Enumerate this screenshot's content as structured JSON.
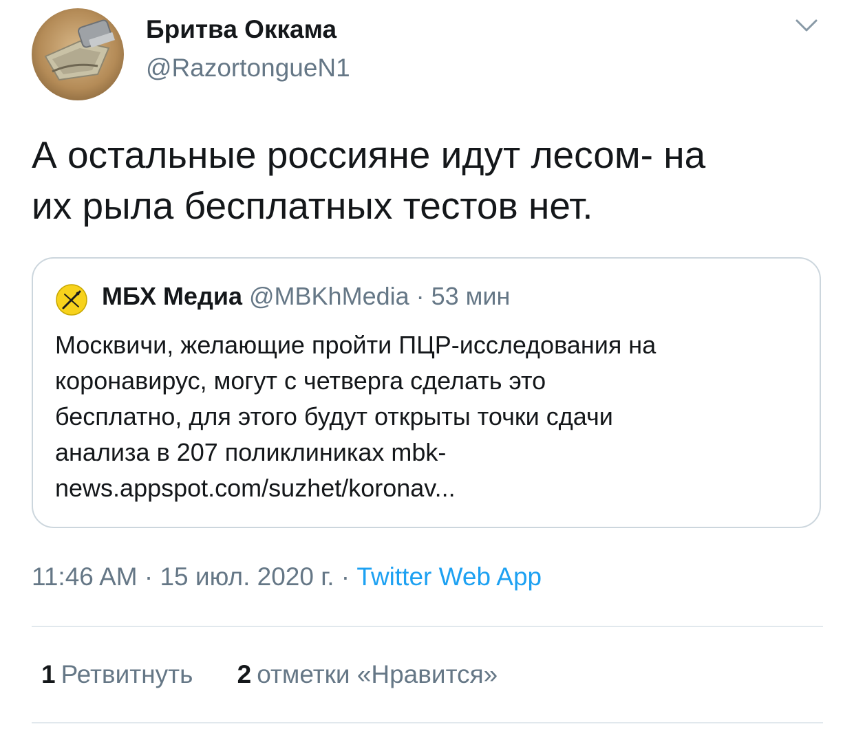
{
  "author": {
    "name": "Бритва Оккама",
    "handle": "@RazortongueN1",
    "avatar_icon": "razor-blade-photo"
  },
  "tweet": {
    "line1": "А остальные россияне идут лесом- на",
    "line2": "их рыла бесплатных тестов нет."
  },
  "quote": {
    "avatar_icon": "mbh-logo",
    "name": "МБХ Медиа",
    "meta": "@MBKhMedia · 53 мин",
    "lines": [
      "Москвичи, желающие пройти ПЦР-исследования на",
      "коронавирус, могут с четверга сделать это",
      "бесплатно, для этого будут открыты точки сдачи",
      "анализа в 207 поликлиниках mbk-",
      "news.appspot.com/suzhet/koronav..."
    ]
  },
  "meta": {
    "time_date": "11:46 AM · 15 июл. 2020 г. · ",
    "source": "Twitter Web App"
  },
  "stats": {
    "retweets_count": "1",
    "retweets_label": "Ретвитнуть",
    "likes_count": "2",
    "likes_label": "отметки «Нравится»"
  },
  "colors": {
    "link": "#1da1f2",
    "secondary_text": "#657786",
    "border": "#ccd6dd"
  }
}
